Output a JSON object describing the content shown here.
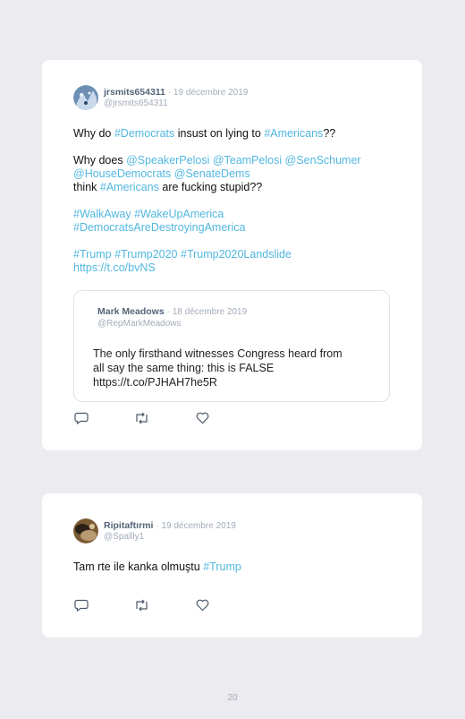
{
  "tweets": [
    {
      "username": "jrsmits654311",
      "date": "· 19 décembre 2019",
      "handle": "@jrsmits654311",
      "lines": [
        [
          {
            "t": "Why do ",
            "l": false
          },
          {
            "t": "#Democrats",
            "l": true
          },
          {
            "t": " insust on lying to ",
            "l": false
          },
          {
            "t": "#Americans",
            "l": true
          },
          {
            "t": "??",
            "l": false
          }
        ],
        [
          {
            "t": "Why does ",
            "l": false
          },
          {
            "t": "@SpeakerPelosi",
            "l": true
          },
          {
            "t": " ",
            "l": false
          },
          {
            "t": "@TeamPelosi",
            "l": true
          },
          {
            "t": " ",
            "l": false
          },
          {
            "t": "@SenSchumer",
            "l": true
          }
        ],
        [
          {
            "t": "@HouseDemocrats",
            "l": true
          },
          {
            "t": " ",
            "l": false
          },
          {
            "t": "@SenateDems",
            "l": true
          }
        ],
        [
          {
            "t": "think ",
            "l": false
          },
          {
            "t": "#Americans",
            "l": true
          },
          {
            "t": " are fucking stupid??",
            "l": false
          }
        ],
        [
          {
            "t": "#WalkAway",
            "l": true
          },
          {
            "t": " ",
            "l": false
          },
          {
            "t": "#WakeUpAmerica",
            "l": true
          }
        ],
        [
          {
            "t": "#DemocratsAreDestroyingAmerica",
            "l": true
          }
        ],
        [
          {
            "t": "#Trump",
            "l": true
          },
          {
            "t": " ",
            "l": false
          },
          {
            "t": "#Trump2020",
            "l": true
          },
          {
            "t": " ",
            "l": false
          },
          {
            "t": "#Trump2020Landslide",
            "l": true
          }
        ],
        [
          {
            "t": "https://t.co/bvNS",
            "l": true
          }
        ]
      ],
      "quote": {
        "username": "Mark Meadows",
        "date": "· 18 décembre 2019",
        "handle": "@RepMarkMeadows",
        "lines": [
          "The only firsthand witnesses Congress heard from",
          "all say the same thing: this is FALSE",
          "https://t.co/PJHAH7he5R"
        ]
      }
    },
    {
      "username": "Ripitaftırmi",
      "date": "· 19 décembre 2019",
      "handle": "@Spallly1",
      "lines": [
        [
          {
            "t": "Tam rte ile kanka olmuştu ",
            "l": false
          },
          {
            "t": "#Trump",
            "l": true
          }
        ]
      ]
    }
  ],
  "icons": [
    "reply-icon",
    "retweet-icon",
    "like-icon"
  ],
  "page_number": "20",
  "colors": {
    "link": "#52b7e0",
    "background": "#ebebf0",
    "username": "#546479"
  }
}
